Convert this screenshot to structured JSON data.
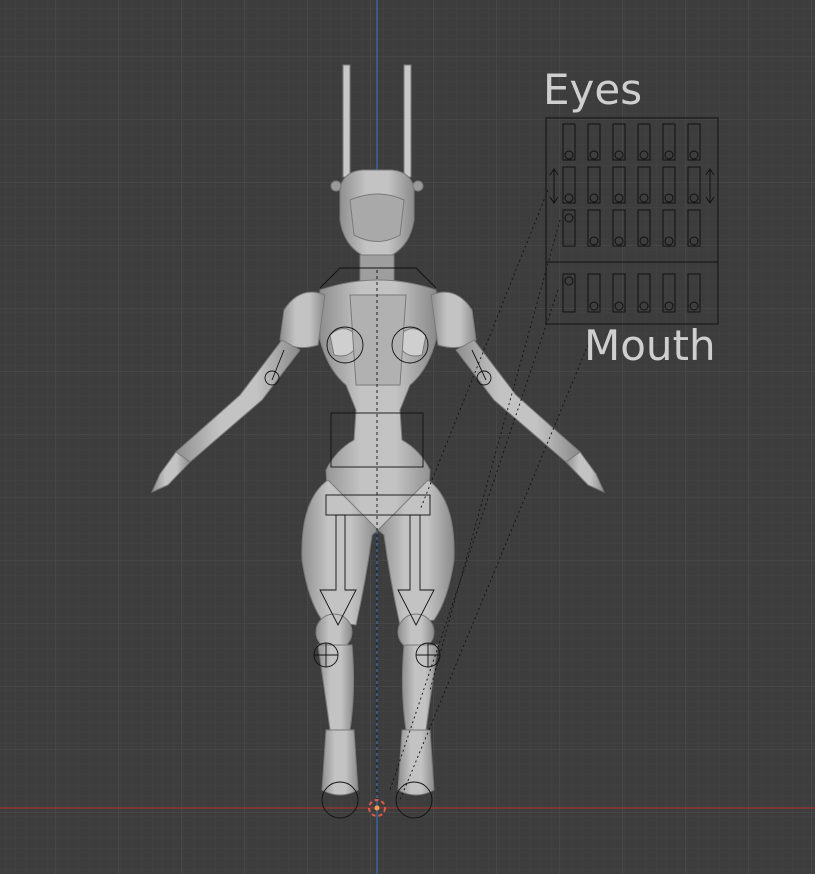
{
  "viewport": {
    "background_color": "#3d3d3d",
    "grid_color": "#555555",
    "x_axis_color": "#9a3a3a",
    "z_axis_color": "#3a6fb0",
    "mesh_color": "#b9b9b9"
  },
  "annotations": {
    "eyes_label": "Eyes",
    "mouth_label": "Mouth"
  },
  "icons": {
    "origin": "3d-cursor-icon",
    "arrow": "double-arrow-icon"
  }
}
